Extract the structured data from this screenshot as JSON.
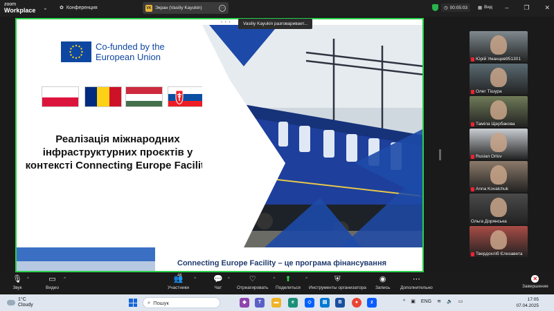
{
  "app": {
    "logo_line1": "zoom",
    "logo_line2": "Workplace",
    "meeting_label": "Конференция",
    "screen_share_label": "Экран (Vasiliy Kayukin)",
    "screen_share_avatar": "VK",
    "timer": "00:05:03",
    "view_label": "Вид",
    "speaking_tooltip": "Vasiliy Kayukin разговаривает..."
  },
  "slide": {
    "eu_text_line1": "Co-funded by the",
    "eu_text_line2": "European Union",
    "title": "Реалізація міжнародних інфраструктурних проєктів у контексті Connecting Europe Facility",
    "bottom_caption": "Connecting Europe Facility – це програма фінансування",
    "flags": [
      "poland",
      "romania",
      "hungary",
      "slovakia"
    ],
    "colors": {
      "eu_blue": "#0e47a1",
      "accent_blue": "#1d4aa8",
      "train_blue": "#1e3f9c"
    }
  },
  "participants": [
    {
      "name": "Юрій Уманцев951301",
      "muted": true,
      "bg": "#7f8a8f"
    },
    {
      "name": "Олег Тішура",
      "muted": true,
      "bg": "#5a6b72"
    },
    {
      "name": "Таміла Щербакова",
      "muted": true,
      "bg": "#6f7b58"
    },
    {
      "name": "Ruslan Orlov",
      "muted": true,
      "bg": "#c9cdd2"
    },
    {
      "name": "Anna Kovalchuk",
      "muted": true,
      "bg": "#8c7a6a"
    },
    {
      "name": "Ольга Дорянська",
      "muted": false,
      "bg": "#4a4a4a"
    },
    {
      "name": "Твердохліб Єлизавета",
      "muted": true,
      "bg": "#a84c45"
    }
  ],
  "toolbar": {
    "audio": "Звук",
    "video": "Видео",
    "participants": "Участники",
    "participants_count": "46",
    "chat": "Чат",
    "react": "Отреагировать",
    "share": "Поделиться",
    "host_tools": "Инструменты организатора",
    "record": "Запись",
    "more": "Дополнительно",
    "end": "Завершение"
  },
  "taskbar": {
    "temperature": "1°C",
    "weather": "Cloudy",
    "search_placeholder": "Пошук",
    "lang": "ENG",
    "time": "17:05",
    "date": "07.04.2025"
  }
}
